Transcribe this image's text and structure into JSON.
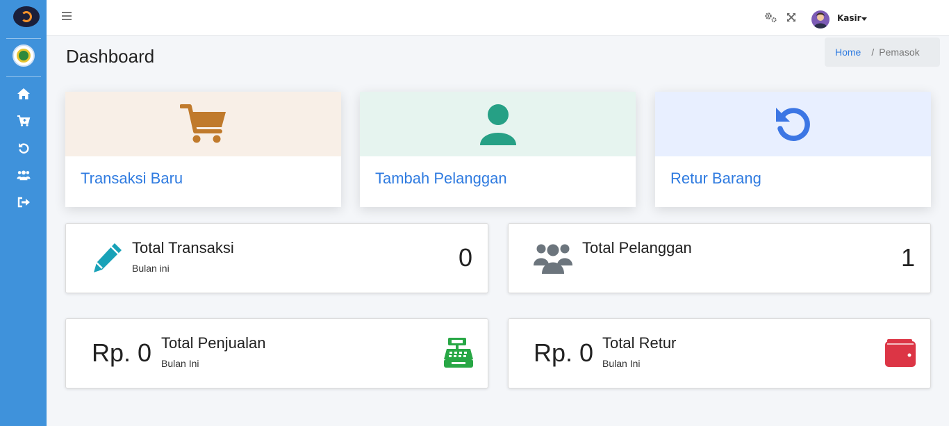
{
  "topnav": {
    "user_name": "Kasir"
  },
  "header": {
    "title": "Dashboard",
    "breadcrumb": {
      "home": "Home",
      "separator": "/",
      "current": "Pemasok"
    }
  },
  "quick_actions": [
    {
      "label": "Transaksi Baru",
      "icon": "cart-icon",
      "bg": "#f8efe7",
      "icon_color": "#c07a2c"
    },
    {
      "label": "Tambah Pelanggan",
      "icon": "user-icon",
      "bg": "#e6f4ef",
      "icon_color": "#26a085"
    },
    {
      "label": "Retur Barang",
      "icon": "undo-icon",
      "bg": "#e8efff",
      "icon_color": "#3c76e4"
    }
  ],
  "stats": [
    {
      "title": "Total Transaksi",
      "subtitle": "Bulan ini",
      "value": "0",
      "icon": "pencil-icon",
      "icon_color": "#18a2b8"
    },
    {
      "title": "Total Pelanggan",
      "value": "1",
      "icon": "users-icon",
      "icon_color": "#6c757d"
    },
    {
      "title": "Total Penjualan",
      "subtitle": "Bulan Ini",
      "value": "Rp. 0",
      "icon": "cash-register-icon",
      "icon_color": "#28a745"
    },
    {
      "title": "Total Retur",
      "subtitle": "Bulan Ini",
      "value": "Rp. 0",
      "icon": "wallet-icon",
      "icon_color": "#dc3545"
    }
  ],
  "sidebar": {
    "items": [
      {
        "icon": "home-icon"
      },
      {
        "icon": "cart-plus-icon"
      },
      {
        "icon": "undo-icon"
      },
      {
        "icon": "users-icon"
      },
      {
        "icon": "sign-out-icon"
      }
    ]
  }
}
